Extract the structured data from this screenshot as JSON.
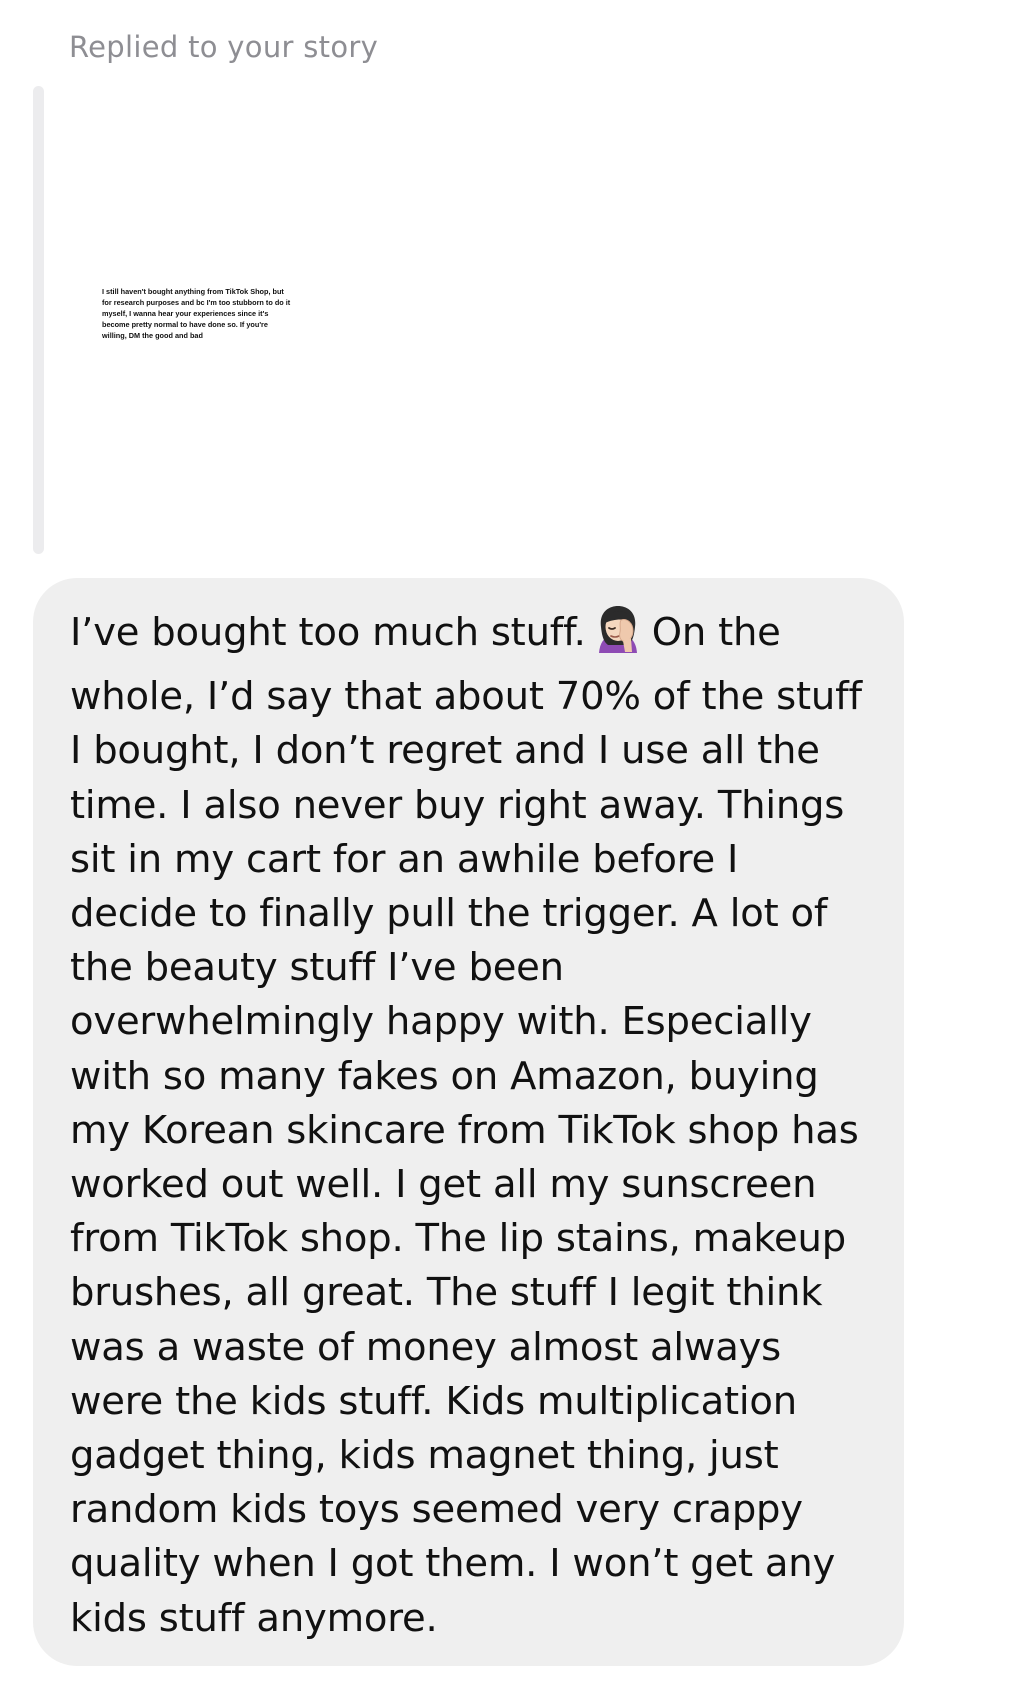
{
  "reply": {
    "header": "Replied to your story"
  },
  "story": {
    "text": "I still haven't bought anything from TikTok Shop, but for research purposes and bc I'm too stubborn to do it myself, I wanna hear your experiences since it's become pretty normal to have done so. If you're willing, DM the good and bad"
  },
  "message": {
    "text_before_emoji": "I’ve bought too much stuff.",
    "emoji": "woman-facepalming-icon",
    "text_after_emoji": "On the whole, I’d say that about 70% of the stuff I bought, I don’t regret and I use all the time. I also never buy right away. Things sit in my cart for an awhile before I decide to finally pull the trigger. A lot of the beauty stuff I’ve been overwhelmingly happy with. Especially with so many fakes on Amazon, buying my Korean skincare from TikTok shop has worked out well. I get all my sunscreen from TikTok shop. The lip stains, makeup brushes, all great. The stuff I legit think was a waste of money almost always were the kids stuff. Kids multiplication gadget thing, kids magnet thing, just random kids toys seemed very crappy quality when I got them. I won’t get any kids stuff anymore."
  },
  "colors": {
    "header_text": "#8e8e93",
    "bubble_background": "#efefef",
    "quote_bar": "#ececee",
    "message_text": "#111111"
  }
}
